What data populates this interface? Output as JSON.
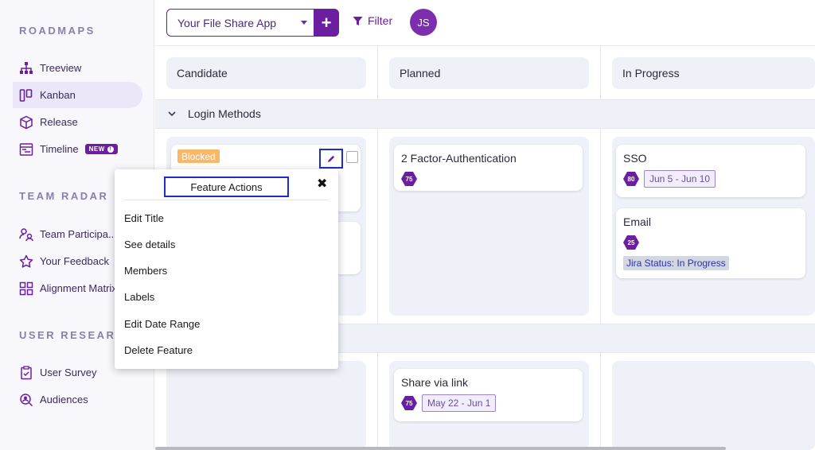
{
  "sidebar": {
    "sections": [
      {
        "title": "ROADMAPS"
      },
      {
        "title": "TEAM RADAR"
      },
      {
        "title": "USER RESEARCH"
      }
    ],
    "items": [
      {
        "label": "Treeview",
        "icon": "hierarchy-icon"
      },
      {
        "label": "Kanban",
        "icon": "kanban-icon",
        "active": true
      },
      {
        "label": "Release",
        "icon": "cube-icon"
      },
      {
        "label": "Timeline",
        "icon": "timeline-icon",
        "badge": "NEW"
      },
      {
        "label": "Team Participa...",
        "icon": "people-icon"
      },
      {
        "label": "Your Feedback",
        "icon": "star-icon"
      },
      {
        "label": "Alignment Matrix",
        "icon": "grid-icon"
      },
      {
        "label": "User Survey",
        "icon": "clipboard-icon"
      },
      {
        "label": "Audiences",
        "icon": "search-user-icon"
      }
    ]
  },
  "header": {
    "app_select": "Your File Share App",
    "add_label": "+",
    "filter_label": "Filter",
    "avatar_initials": "JS"
  },
  "board": {
    "columns": [
      "Candidate",
      "Planned",
      "In Progress"
    ],
    "group_label": "Login Methods",
    "cards": {
      "candidate_blocked": {
        "tag": "Blocked"
      },
      "planned_2fa": {
        "title": "2 Factor-Authentication",
        "score": "75"
      },
      "progress_sso": {
        "title": "SSO",
        "score": "80",
        "dates": "Jun 5 - Jun 10"
      },
      "progress_email": {
        "title": "Email",
        "score": "25",
        "jira": "Jira Status: In Progress"
      },
      "planned_share": {
        "title": "Share via link",
        "score": "75",
        "dates": "May 22 - Jun 1"
      }
    }
  },
  "popup": {
    "title": "Feature Actions",
    "close": "✖",
    "items": [
      "Edit Title",
      "See details",
      "Members",
      "Labels",
      "Edit Date Range",
      "Delete Feature"
    ]
  },
  "colors": {
    "accent": "#6b1fa0",
    "lane_bg": "#eef1f7",
    "blocked": "#f7b86a",
    "focus_outline": "#1f2cc8"
  }
}
